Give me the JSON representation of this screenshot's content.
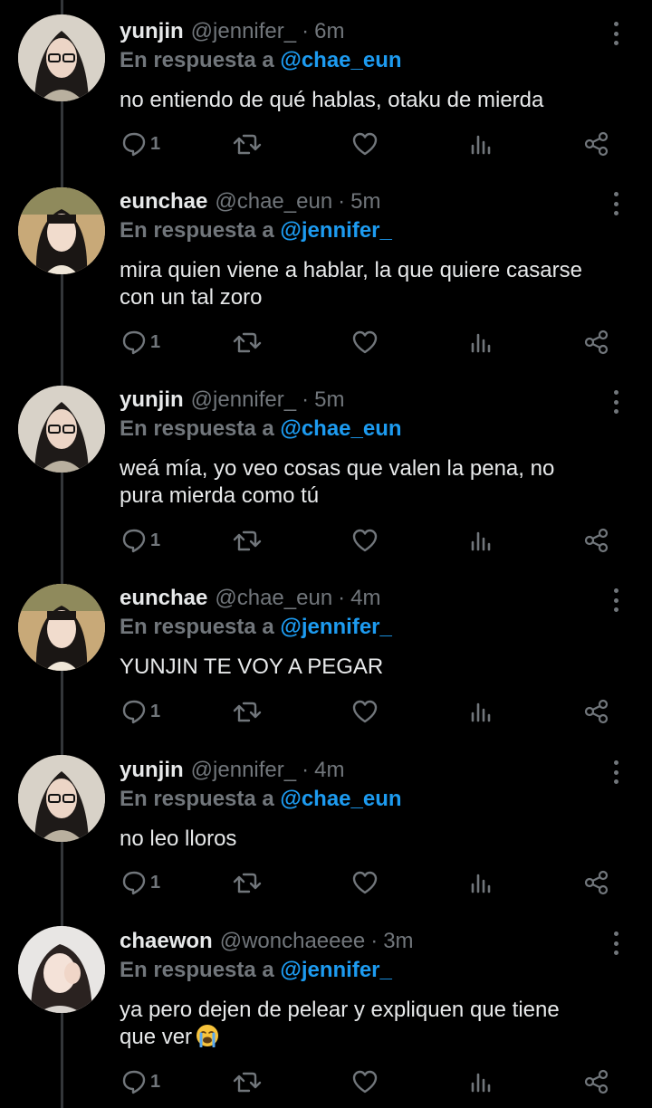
{
  "reply_prefix": "En respuesta a",
  "tweets": [
    {
      "name": "yunjin",
      "handle": "@jennifer_",
      "time": "6m",
      "reply_to": "@chae_eun",
      "lines": [
        "no entiendo de qué hablas, otaku de mierda"
      ],
      "reply_count": "1",
      "avatar": "yunjin-avatar"
    },
    {
      "name": "eunchae",
      "handle": "@chae_eun",
      "time": "5m",
      "reply_to": "@jennifer_",
      "lines": [
        "mira quien viene a hablar, la que quiere casarse",
        "con un tal zoro"
      ],
      "reply_count": "1",
      "avatar": "eunchae-avatar"
    },
    {
      "name": "yunjin",
      "handle": "@jennifer_",
      "time": "5m",
      "reply_to": "@chae_eun",
      "lines": [
        "weá mía, yo veo cosas que valen la pena, no",
        "pura mierda como tú"
      ],
      "reply_count": "1",
      "avatar": "yunjin-avatar"
    },
    {
      "name": "eunchae",
      "handle": "@chae_eun",
      "time": "4m",
      "reply_to": "@jennifer_",
      "lines": [
        "YUNJIN TE VOY A PEGAR"
      ],
      "reply_count": "1",
      "avatar": "eunchae-avatar"
    },
    {
      "name": "yunjin",
      "handle": "@jennifer_",
      "time": "4m",
      "reply_to": "@chae_eun",
      "lines": [
        "no leo lloros"
      ],
      "reply_count": "1",
      "avatar": "yunjin-avatar"
    },
    {
      "name": "chaewon",
      "handle": "@wonchaeeee",
      "time": "3m",
      "reply_to": "@jennifer_",
      "lines": [
        "ya pero dejen de pelear y expliquen que tiene",
        "que ver"
      ],
      "emoji": "loudly-crying-face-emoji",
      "reply_count": "1",
      "avatar": "chaewon-avatar"
    }
  ],
  "colors": {
    "background": "#000000",
    "text": "#e7e9ea",
    "muted": "#71767b",
    "mention": "#1d9bf0"
  },
  "icons": [
    "reply-icon",
    "retweet-icon",
    "like-icon",
    "views-icon",
    "share-icon",
    "more-icon"
  ]
}
